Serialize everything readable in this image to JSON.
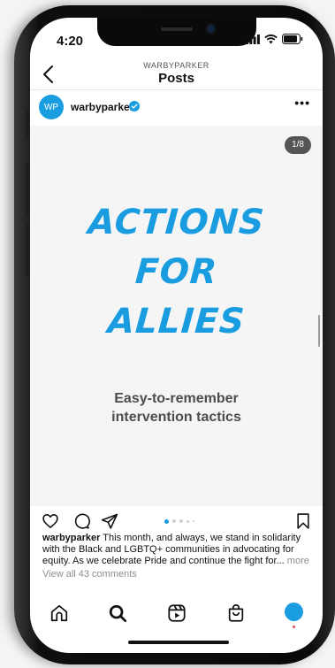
{
  "status_bar": {
    "time": "4:20"
  },
  "header": {
    "account": "WARBYPARKER",
    "title": "Posts"
  },
  "post_header": {
    "avatar_initials": "WP",
    "username": "warbyparker"
  },
  "post": {
    "slide_counter": "1/8",
    "headline_lines": [
      "ACTIONS",
      "FOR",
      "ALLIES"
    ],
    "tagline_lines": [
      "Easy-to-remember",
      "intervention tactics"
    ],
    "carousel": {
      "total_dots_visible": 5,
      "active_index": 0
    }
  },
  "caption": {
    "username": "warbyparker",
    "text": " This month, and always, we stand in solidarity with the Black and LGBTQ+ communities in advocating for equity. As we celebrate Pride and continue the fight for...",
    "more": " more"
  },
  "comments_link": "View all 43 comments",
  "colors": {
    "brand_blue": "#1a9de0",
    "tagline_gray": "#4d4d4d",
    "notification_red": "#ed4956"
  },
  "icons": {
    "header": [
      "back-chevron-icon"
    ],
    "post_header": [
      "verified-badge-icon",
      "more-options-icon"
    ],
    "actions": [
      "heart-icon",
      "comment-icon",
      "share-icon",
      "bookmark-icon"
    ],
    "tab_bar": [
      "home-icon",
      "search-icon",
      "reels-icon",
      "shop-icon",
      "profile-avatar"
    ]
  }
}
